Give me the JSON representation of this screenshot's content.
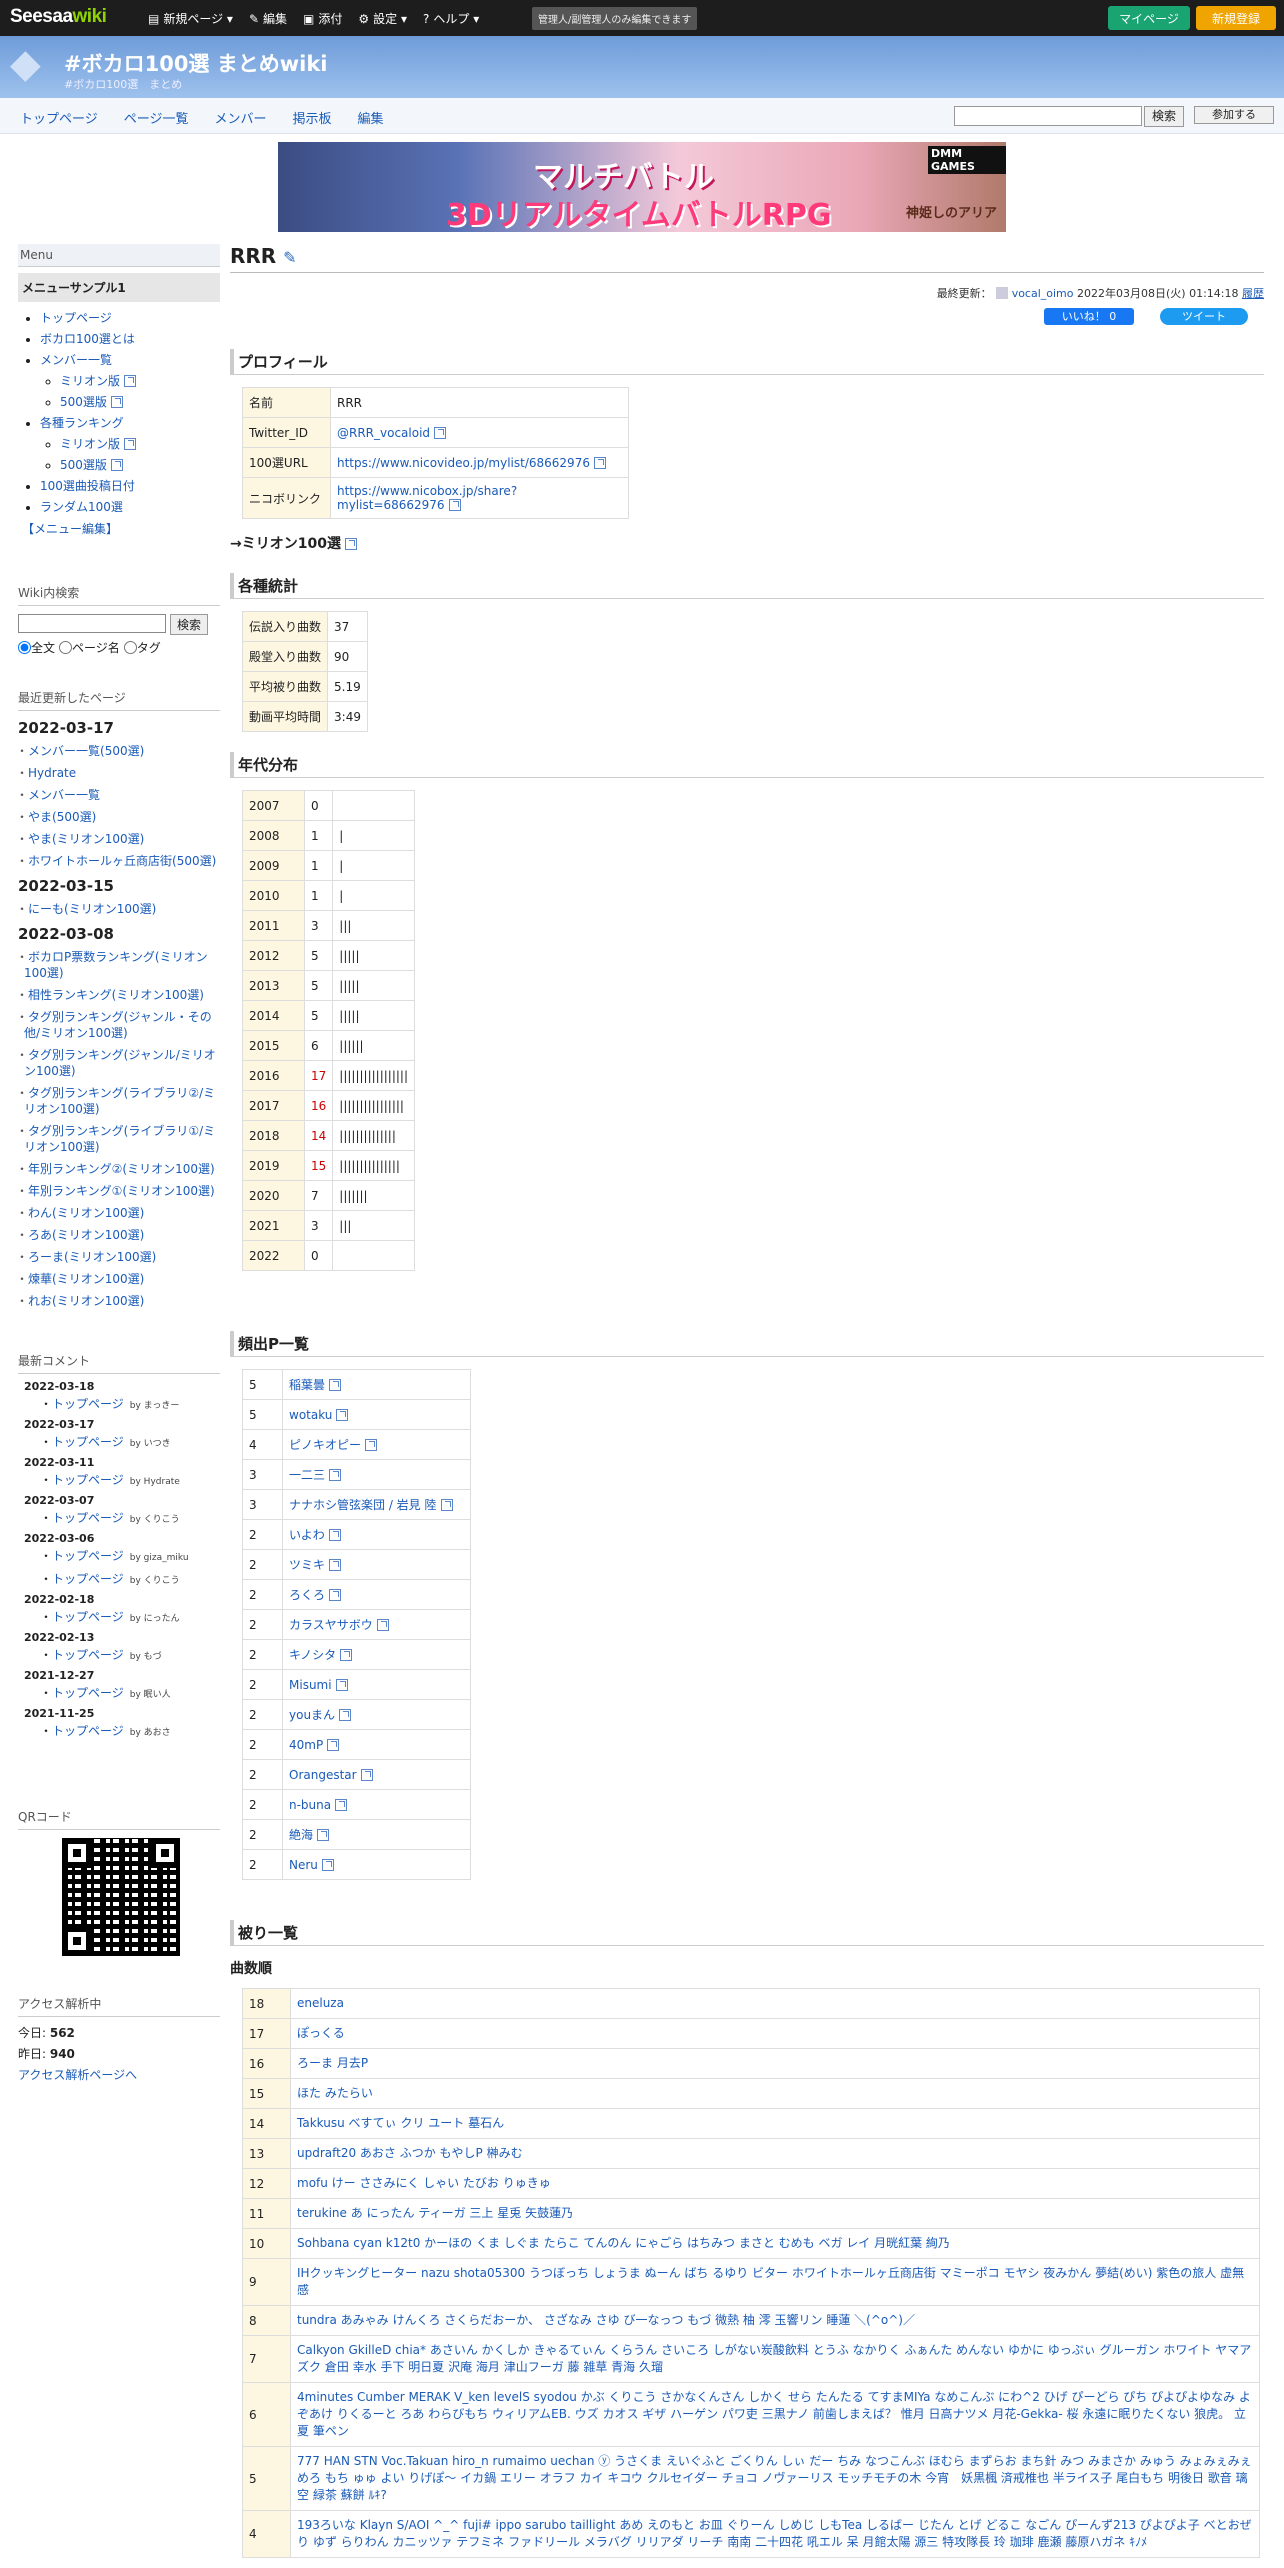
{
  "topbar": {
    "logo_a": "Seesaa",
    "logo_b": "wiki",
    "menu": [
      "新規ページ",
      "編集",
      "添付",
      "設定",
      "ヘルプ"
    ],
    "note": "管理人/副管理人のみ編集できます",
    "mypage": "マイページ",
    "signup": "新規登録"
  },
  "header": {
    "title": "#ボカロ100選 まとめwiki",
    "subtitle": "#ボカロ100選　まとめ"
  },
  "nav": {
    "items": [
      "トップページ",
      "ページ一覧",
      "メンバー",
      "掲示板",
      "編集"
    ],
    "search_button": "検索",
    "join": "参加する"
  },
  "banner": {
    "line1": "マルチバトル",
    "line2": "3DリアルタイムバトルRPG",
    "maker": "DMM GAMES",
    "logo": "神姫しのアリア"
  },
  "side": {
    "menu_heading": "Menu",
    "menu_box": "メニューサンプル1",
    "menu": [
      {
        "t": "トップページ",
        "s": false,
        "e": false
      },
      {
        "t": "ボカロ100選とは",
        "s": false,
        "e": false
      },
      {
        "t": "メンバー一覧",
        "s": false,
        "e": false
      },
      {
        "t": "ミリオン版",
        "s": true,
        "e": true
      },
      {
        "t": "500選版",
        "s": true,
        "e": true
      },
      {
        "t": "各種ランキング",
        "s": false,
        "e": false
      },
      {
        "t": "ミリオン版",
        "s": true,
        "e": true
      },
      {
        "t": "500選版",
        "s": true,
        "e": true
      },
      {
        "t": "100選曲投稿日付",
        "s": false,
        "e": false
      },
      {
        "t": "ランダム100選",
        "s": false,
        "e": false
      }
    ],
    "menu_edit": "【メニュー編集】",
    "search_heading": "Wiki内検索",
    "search_button": "検索",
    "radios": [
      "全文",
      "ページ名",
      "タグ"
    ],
    "recent_heading": "最近更新したページ",
    "recent": [
      {
        "date": "2022-03-17",
        "items": [
          "メンバー一覧(500選)",
          "Hydrate",
          "メンバー一覧",
          "やま(500選)",
          "やま(ミリオン100選)",
          "ホワイトホールヶ丘商店街(500選)"
        ]
      },
      {
        "date": "2022-03-15",
        "items": [
          "にーも(ミリオン100選)"
        ]
      },
      {
        "date": "2022-03-08",
        "items": [
          "ボカロP票数ランキング(ミリオン100選)",
          "相性ランキング(ミリオン100選)",
          "タグ別ランキング(ジャンル・その他/ミリオン100選)",
          "タグ別ランキング(ジャンル/ミリオン100選)",
          "タグ別ランキング(ライブラリ②/ミリオン100選)",
          "タグ別ランキング(ライブラリ①/ミリオン100選)",
          "年別ランキング②(ミリオン100選)",
          "年別ランキング①(ミリオン100選)",
          "わん(ミリオン100選)",
          "ろあ(ミリオン100選)",
          "ろーま(ミリオン100選)",
          "煉華(ミリオン100選)",
          "れお(ミリオン100選)"
        ]
      }
    ],
    "comments_heading": "最新コメント",
    "comments": [
      {
        "date": "2022-03-18",
        "items": [
          {
            "t": "トップページ",
            "by": "by まっきー"
          }
        ]
      },
      {
        "date": "2022-03-17",
        "items": [
          {
            "t": "トップページ",
            "by": "by いつき"
          }
        ]
      },
      {
        "date": "2022-03-11",
        "items": [
          {
            "t": "トップページ",
            "by": "by Hydrate"
          }
        ]
      },
      {
        "date": "2022-03-07",
        "items": [
          {
            "t": "トップページ",
            "by": "by くりこう"
          }
        ]
      },
      {
        "date": "2022-03-06",
        "items": [
          {
            "t": "トップページ",
            "by": "by giza_miku"
          },
          {
            "t": "トップページ",
            "by": "by くりこう"
          }
        ]
      },
      {
        "date": "2022-02-18",
        "items": [
          {
            "t": "トップページ",
            "by": "by にったん"
          }
        ]
      },
      {
        "date": "2022-02-13",
        "items": [
          {
            "t": "トップページ",
            "by": "by もづ"
          }
        ]
      },
      {
        "date": "2021-12-27",
        "items": [
          {
            "t": "トップページ",
            "by": "by 眠い人"
          }
        ]
      },
      {
        "date": "2021-11-25",
        "items": [
          {
            "t": "トップページ",
            "by": "by あおさ"
          }
        ]
      }
    ],
    "qr_heading": "QRコード",
    "access_heading": "アクセス解析中",
    "today_label": "今日: ",
    "today": "562",
    "yest_label": "昨日: ",
    "yest": "940",
    "access_link": "アクセス解析ページへ"
  },
  "main": {
    "title": "RRR",
    "updated_label": "最終更新：",
    "updated_user": "vocal_oimo",
    "updated_time": "2022年03月08日(火) 01:14:18",
    "history": "履歴",
    "fb": "いいね！ 0",
    "tw": "ツイート",
    "profile_heading": "プロフィール",
    "profile": [
      {
        "k": "名前",
        "v": "RRR",
        "link": false
      },
      {
        "k": "Twitter_ID",
        "v": "@RRR_vocaloid",
        "link": true
      },
      {
        "k": "100選URL",
        "v": "https://www.nicovideo.jp/mylist/68662976",
        "link": true
      },
      {
        "k": "ニコボリンク",
        "v": "https://www.nicobox.jp/share?mylist=68662976",
        "link": true
      }
    ],
    "million_link": "→ミリオン100選",
    "stats_heading": "各種統計",
    "stats": [
      {
        "k": "伝説入り曲数",
        "v": "37"
      },
      {
        "k": "殿堂入り曲数",
        "v": "90"
      },
      {
        "k": "平均被り曲数",
        "v": "5.19"
      },
      {
        "k": "動画平均時間",
        "v": "3:49"
      }
    ],
    "years_heading": "年代分布",
    "years": [
      {
        "y": "2007",
        "n": "0",
        "r": false,
        "b": ""
      },
      {
        "y": "2008",
        "n": "1",
        "r": false,
        "b": "|"
      },
      {
        "y": "2009",
        "n": "1",
        "r": false,
        "b": "|"
      },
      {
        "y": "2010",
        "n": "1",
        "r": false,
        "b": "|"
      },
      {
        "y": "2011",
        "n": "3",
        "r": false,
        "b": "|||"
      },
      {
        "y": "2012",
        "n": "5",
        "r": false,
        "b": "|||||"
      },
      {
        "y": "2013",
        "n": "5",
        "r": false,
        "b": "|||||"
      },
      {
        "y": "2014",
        "n": "5",
        "r": false,
        "b": "|||||"
      },
      {
        "y": "2015",
        "n": "6",
        "r": false,
        "b": "||||||"
      },
      {
        "y": "2016",
        "n": "17",
        "r": true,
        "b": "|||||||||||||||||"
      },
      {
        "y": "2017",
        "n": "16",
        "r": true,
        "b": "||||||||||||||||"
      },
      {
        "y": "2018",
        "n": "14",
        "r": true,
        "b": "||||||||||||||"
      },
      {
        "y": "2019",
        "n": "15",
        "r": true,
        "b": "|||||||||||||||"
      },
      {
        "y": "2020",
        "n": "7",
        "r": false,
        "b": "|||||||"
      },
      {
        "y": "2021",
        "n": "3",
        "r": false,
        "b": "|||"
      },
      {
        "y": "2022",
        "n": "0",
        "r": false,
        "b": ""
      }
    ],
    "freq_heading": "頻出P一覧",
    "freq": [
      {
        "n": "5",
        "p": "稲葉曇"
      },
      {
        "n": "5",
        "p": "wotaku"
      },
      {
        "n": "4",
        "p": "ピノキオピー"
      },
      {
        "n": "3",
        "p": "一二三"
      },
      {
        "n": "3",
        "p": "ナナホシ管弦楽団 / 岩見 陸"
      },
      {
        "n": "2",
        "p": "いよわ"
      },
      {
        "n": "2",
        "p": "ツミキ"
      },
      {
        "n": "2",
        "p": "ろくろ"
      },
      {
        "n": "2",
        "p": "カラスヤサボウ"
      },
      {
        "n": "2",
        "p": "キノシタ"
      },
      {
        "n": "2",
        "p": "Misumi"
      },
      {
        "n": "2",
        "p": "youまん"
      },
      {
        "n": "2",
        "p": "40mP"
      },
      {
        "n": "2",
        "p": "Orangestar"
      },
      {
        "n": "2",
        "p": "n-buna"
      },
      {
        "n": "2",
        "p": "絶海"
      },
      {
        "n": "2",
        "p": "Neru"
      }
    ],
    "overlap_heading": "被り一覧",
    "overlap_sub": "曲数順",
    "overlap": [
      {
        "n": "18",
        "v": "eneluza"
      },
      {
        "n": "17",
        "v": "ぽっくる"
      },
      {
        "n": "16",
        "v": "ろーま 月去P"
      },
      {
        "n": "15",
        "v": "ほた みたらい"
      },
      {
        "n": "14",
        "v": "Takkusu べすてぃ クリ ユート 墓石ん"
      },
      {
        "n": "13",
        "v": "updraft20 あおさ ふつか もやしP 榊みむ"
      },
      {
        "n": "12",
        "v": "mofu けー ささみにく しゃい たびお りゅきゅ"
      },
      {
        "n": "11",
        "v": "terukine あ にったん ティーガ 三上 星兎 矢鼓蓮乃"
      },
      {
        "n": "10",
        "v": "Sohbana cyan k12t0 かーほの くま しぐま たらこ てんのん にゃごら はちみつ まさと むめも ベガ レイ 月晄紅葉 絢乃"
      },
      {
        "n": "9",
        "v": "IHクッキングヒーター nazu shota05300 うつぼっち しょうま ぬーん ばち るゆり ビター ホワイトホールヶ丘商店街 マミーポコ モヤシ 夜みかん 夢結(めい) 紫色の旅人 虚無感"
      },
      {
        "n": "8",
        "v": "tundra あみゃみ けんくろ さくらだおーか、 さざなみ さゆ び一なっつ もづ 微熱 柚 澪 玉響リン 睡蓮 ＼(^o^)／"
      },
      {
        "n": "7",
        "v": "Calkyon GkilleD chia* あさいん かくしか きゃるてぃん くらうん さいころ しがない炭酸飲料 とうふ なかりく ふぁんた めんない ゆかに ゆっぷぃ グルーガン ホワイト ヤマアズク 倉田 幸水 手下 明日夏 沢庵 海月 津山フーガ 藤 雑草 青海 久瑠"
      },
      {
        "n": "6",
        "v": "4minutes Cumber MERAK V_ken levelS syodou かぶ くりこう さかなくんさん しかく せら たんたる てすまMIYa なめこんぶ にわ^2 ひげ ぴーどら ぴち ぴよぴよゆなみ よぞあけ りくるーと ろあ わらびもち ウィリアムEB. ウズ カオス ギザ ハーゲン パワ吏 三黒ナノ 前歯しまえば？ 惟月 日高ナツメ 月花-Gekka- 桜 永遠に眠りたくない 狼虎。 立夏 筆ペン"
      },
      {
        "n": "5",
        "v": "777 HAN STN Voc.Takuan hiro_n rumaimo uechan ⓨ うさくま えいぐふと ごくりん しぃ だー ちみ なつこんぶ ほむら まずらお まち針 みつ みまさか みゅう みょみぇみぇ めろ もち ゅゅ よい りげぽ～ イカ鍋 エリー オラフ カイ キコウ クルセイダー チョコ ノヴァーリス モッチモチの木 今宵　妖黒楓 済戒椎也 半ライス子 尾白もち 明後日 歌音 璃空 緑茶 蘇餅 ﾙｷ?"
      },
      {
        "n": "4",
        "v": "193ろいな Klayn S/AOI ^_^ fuji# ippo sarubo taillight あめ えのもと お皿 ぐりーん しめじ しもTea しるばー じたん とげ どるこ なごん ぴーんず213 ぴよぴよ子 べとおぜり ゆず らりわん カニッツァ テフミネ ファドリール メラバグ リリアダ リーチ 南南 二十四花 吼エル 呆 月館太陽 源三 特攻隊長 玲 珈琲 鹿瀬 藤原ハガネ ｷﾉﾒ"
      }
    ]
  }
}
